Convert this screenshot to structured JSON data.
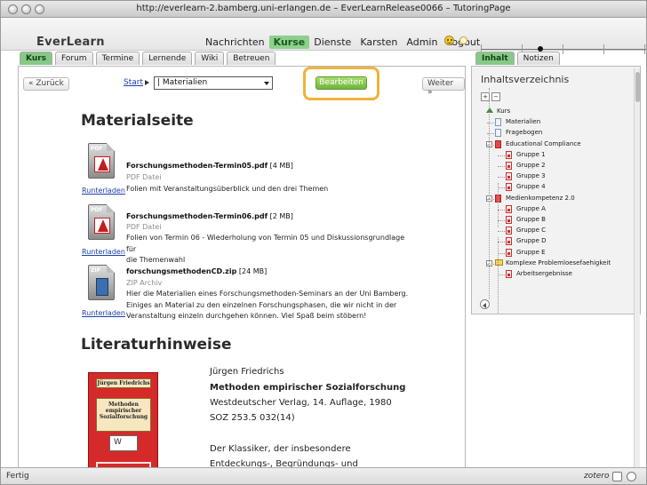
{
  "window": {
    "title": "http://everlearn-2.bamberg.uni-erlangen.de – EverLearnRelease0066 – TutoringPage"
  },
  "app": {
    "logo": "EverLearn",
    "nav": [
      "Nachrichten",
      "Kurse",
      "Dienste",
      "Karsten",
      "Admin",
      "Logout"
    ],
    "active_nav": "Kurse"
  },
  "tabs": [
    "Kurs",
    "Forum",
    "Termine",
    "Lernende",
    "Wiki",
    "Betreuen"
  ],
  "right_tabs": [
    "Inhalt",
    "Notizen"
  ],
  "toolbar": {
    "back_label": "« Zurück",
    "start_label": "Start",
    "select_value": "| Materialien",
    "edit_label": "Bearbeiten",
    "next_label": "Weiter »"
  },
  "main": {
    "heading": "Materialseite",
    "files": [
      {
        "icon_label": "PDF",
        "icon_sub": "Adobe",
        "name": "Forschungsmethoden-Termin05.pdf",
        "size": "[4 MB]",
        "type": "PDF Datei",
        "desc_lines": [
          "Folien mit Veranstaltungsüberblick und den drei Themen"
        ],
        "download": "Runterladen"
      },
      {
        "icon_label": "PDF",
        "icon_sub": "Adobe",
        "name": "Forschungsmethoden-Termin06.pdf",
        "size": "[2 MB]",
        "type": "PDF Datei",
        "desc_lines": [
          "Folien von Termin 06 - Wiederholung von Termin 05 und Diskussionsgrundlage für",
          "die Themenwahl"
        ],
        "download": "Runterladen"
      },
      {
        "icon_label": "ZIP",
        "icon_sub": "",
        "name": "forschungsmethodenCD.zip",
        "size": "[24 MB]",
        "type": "ZIP Archiv",
        "desc_lines": [
          "Hier die Materialien eines Forschungsmethoden-Seminars an der Uni Bamberg.",
          "Einiges an Material zu den einzelnen Forschungsphasen, die wir nicht in der",
          "Veranstaltung einzeln durchgehen können. Viel Spaß beim stöbern!"
        ],
        "download": "Runterladen"
      }
    ],
    "lit_heading": "Literaturhinweise",
    "book_cover": {
      "author": "Jürgen Friedrichs",
      "title_lines": [
        "Methoden",
        "empirischer",
        "Sozialforschung"
      ]
    },
    "book_info": [
      "Jürgen Friedrichs",
      "Methoden empirischer Sozialforschung",
      "Westdeutscher Verlag, 14. Auflage, 1980",
      "SOZ 253.5 032(14)",
      "",
      "Der Klassiker, der insbesondere",
      "Entdeckungs-, Begründungs- und"
    ]
  },
  "sidebar": {
    "title": "Inhaltsverzeichnis",
    "tree": [
      {
        "label": "Kurs",
        "level": 0,
        "icon": "up-icon"
      },
      {
        "label": "Materialien",
        "level": 1,
        "icon": "page-icon"
      },
      {
        "label": "Fragebogen",
        "level": 1,
        "icon": "page-icon"
      },
      {
        "label": "Educational Compliance",
        "level": 1,
        "icon": "book-icon",
        "expand": "-"
      },
      {
        "label": "Gruppe 1",
        "level": 2,
        "icon": "pdf-icon"
      },
      {
        "label": "Gruppe 2",
        "level": 2,
        "icon": "pdf-icon"
      },
      {
        "label": "Gruppe 3",
        "level": 2,
        "icon": "pdf-icon"
      },
      {
        "label": "Gruppe 4",
        "level": 2,
        "icon": "pdf-icon"
      },
      {
        "label": "Medienkompetenz 2.0",
        "level": 1,
        "icon": "book-icon",
        "expand": "-"
      },
      {
        "label": "Gruppe A",
        "level": 2,
        "icon": "pdf-icon"
      },
      {
        "label": "Gruppe B",
        "level": 2,
        "icon": "pdf-icon"
      },
      {
        "label": "Gruppe C",
        "level": 2,
        "icon": "pdf-icon"
      },
      {
        "label": "Gruppe D",
        "level": 2,
        "icon": "pdf-icon"
      },
      {
        "label": "Gruppe E",
        "level": 2,
        "icon": "pdf-icon"
      },
      {
        "label": "Komplexe Problemloesefaehigkeit",
        "level": 1,
        "icon": "folder-icon",
        "expand": "-"
      },
      {
        "label": "Arbeitsergebnisse",
        "level": 2,
        "icon": "pdf-icon"
      }
    ]
  },
  "status": {
    "text": "Fertig",
    "zotero": "zotero"
  }
}
